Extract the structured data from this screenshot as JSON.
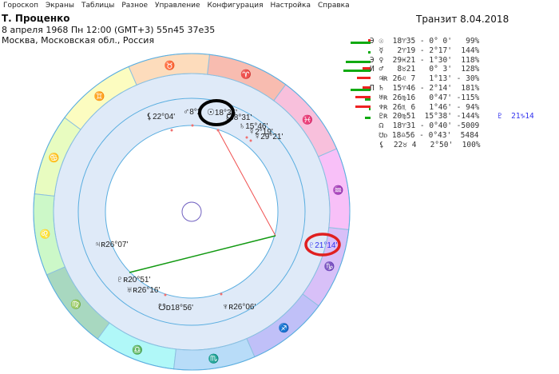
{
  "menu": [
    "Гороскоп",
    "Экраны",
    "Таблицы",
    "Разное",
    "Управление",
    "Конфигурация",
    "Настройка",
    "Справка"
  ],
  "header": {
    "name": "Т. Проценко",
    "datetime": "8 апреля 1968  Пн  12:00 (GMT+3) 55n45  37e35",
    "place": "Москва, Московская обл., Россия"
  },
  "transit_label": "Транзит  8.04.2018",
  "colors": {
    "ring": "#dfeaf8",
    "line": "#5aaee0",
    "aspect_red": "#f05050",
    "aspect_green": "#119911",
    "transit": "#3333ee"
  },
  "signs": [
    {
      "name": "aries",
      "glyph": "♈",
      "color": "#f8bcb0"
    },
    {
      "name": "taurus",
      "glyph": "♉",
      "color": "#fddcbc"
    },
    {
      "name": "gemini",
      "glyph": "♊",
      "color": "#fcfcc0"
    },
    {
      "name": "cancer",
      "glyph": "♋",
      "color": "#e8fcc0"
    },
    {
      "name": "leo",
      "glyph": "♌",
      "color": "#ccf8c8"
    },
    {
      "name": "virgo",
      "glyph": "♍",
      "color": "#a8d8c0"
    },
    {
      "name": "libra",
      "glyph": "♎",
      "color": "#b0f8f8"
    },
    {
      "name": "scorpio",
      "glyph": "♏",
      "color": "#b8dcf8"
    },
    {
      "name": "sagittarius",
      "glyph": "♐",
      "color": "#c0c0f8"
    },
    {
      "name": "capricorn",
      "glyph": "♑",
      "color": "#d8c0f8"
    },
    {
      "name": "aquarius",
      "glyph": "♒",
      "color": "#f8c0f8"
    },
    {
      "name": "pisces",
      "glyph": "♓",
      "color": "#f8c0dc"
    }
  ],
  "chart_labels": [
    {
      "name": "lilith",
      "glyph": "⚸",
      "text": "22°04'"
    },
    {
      "name": "mars",
      "glyph": "♂",
      "text": "8°2"
    },
    {
      "name": "sun",
      "glyph": "☉",
      "text": "18°35'"
    },
    {
      "name": "node",
      "glyph": "☊",
      "text": "8°31'"
    },
    {
      "name": "saturn",
      "glyph": "♄",
      "text": "15°46'"
    },
    {
      "name": "mercury",
      "glyph": "☿",
      "text": "2°19'"
    },
    {
      "name": "venus",
      "glyph": "♀",
      "text": "29°21'"
    },
    {
      "name": "jupiter",
      "glyph": "♃ʀ",
      "text": "26°07'"
    },
    {
      "name": "pluto",
      "glyph": "♇ʀ",
      "text": "20°51'"
    },
    {
      "name": "uranus",
      "glyph": "♅ʀ",
      "text": "26°16'"
    },
    {
      "name": "south-node",
      "glyph": "☋ᴅ",
      "text": "18°56'"
    },
    {
      "name": "neptune",
      "glyph": "♆ʀ",
      "text": "26°06'"
    },
    {
      "name": "transit-pluto",
      "glyph": "♇",
      "text": "21°14'"
    }
  ],
  "table": [
    {
      "text": "Э ☉  18♈35 - 0° 0'   99%",
      "green": 0.75,
      "red": 0.08
    },
    {
      "text": "  ☿   2♈19 - 2°17'  144%",
      "green": 0.1,
      "red": 0
    },
    {
      "text": "Э ♀  29♓21 - 1°30'  118%",
      "green": 0.9,
      "red": 0
    },
    {
      "text": "И ♂   8♉21   0° 3'  128%",
      "green": 1.0,
      "red": 0.3
    },
    {
      "text": "  ♃ʀ 26♌ 7   1°13' - 30%",
      "green": 0,
      "red": 0.5
    },
    {
      "text": "П ♄  15♈46 - 2°14'  181%",
      "green": 0.75,
      "red": 0.3
    },
    {
      "text": "  ♅ʀ 26♍16   0°47' -115%",
      "green": 0.2,
      "red": 0.55
    },
    {
      "text": "  ♆ʀ 26♏ 6   1°46' - 94%",
      "green": 0.05,
      "red": 0.55
    },
    {
      "text": "  ♇ʀ 20♍51  15°38' -144%",
      "green": 0.2,
      "red": 0,
      "transit": "♇  21♑14"
    },
    {
      "text": "  ☊  18♈31 - 0°40' -5009",
      "green": 0,
      "red": 0
    },
    {
      "text": "  ☋ᴅ 18♎56 - 0°43'  5484",
      "green": 0,
      "red": 0
    },
    {
      "text": "  ⚸  22♉ 4   2°50'  100%",
      "green": 0,
      "red": 0
    }
  ]
}
